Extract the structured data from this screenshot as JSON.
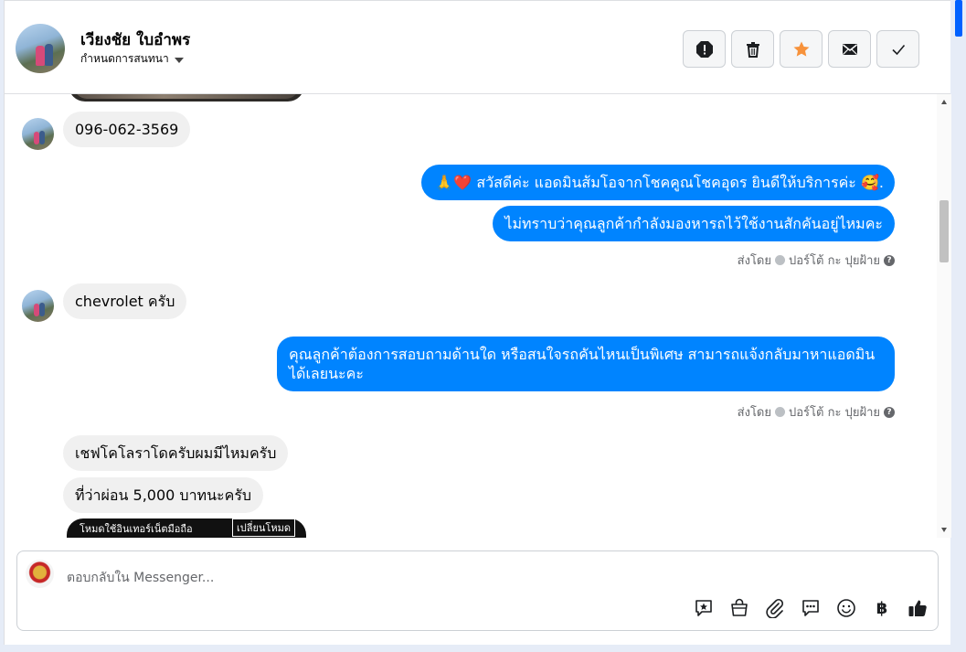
{
  "header": {
    "name": "เวียงชัย ใบอำพร",
    "assign_label": "กำหนดการสนทนา",
    "actions": [
      "alert",
      "delete",
      "star",
      "mail",
      "done"
    ],
    "colors": {
      "star": "#f7923b",
      "icon": "#333333"
    }
  },
  "messages": {
    "phone": "096-062-3569",
    "greeting": "🙏❤️ สวัสดีค่ะ แอดมินส้มโอจากโชคคูณโชคอุดร ยินดีให้บริการค่ะ 🥰.",
    "ask_car": "ไม่ทราบว่าคุณลูกค้ากำลังมองหารถไว้ใช้งานสักคันอยู่ไหมคะ",
    "sent_by_1": "ส่งโดย",
    "sender_1": "ปอร์โต้ กะ ปุยฝ้าย",
    "reply_chevrolet": "chevrolet ครับ",
    "ask_more": "คุณลูกค้าต้องการสอบถามด้านใด หรือสนใจรถคันไหนเป็นพิเศษ สามารถแจ้งกลับมาหาแอดมินได้เลยนะคะ",
    "sent_by_2": "ส่งโดย",
    "sender_2": "ปอร์โต้ กะ ปุยฝ้าย",
    "reply_colorado": "เชฟโคโลราโดครับผมมีไหมครับ",
    "reply_installment": "ที่ว่าผ่อน 5,000 บาทนะครับ",
    "image_caption_left": "โหมดใช้อินเทอร์เน็ตมือถือ",
    "image_caption_right": "เปลี่ยนโหมด"
  },
  "composer": {
    "placeholder": "ตอบกลับใน Messenger...",
    "tools": [
      "saved-reply-icon",
      "shop-bag-icon",
      "attach-icon",
      "chat-dots-icon",
      "emoji-icon",
      "baht-icon",
      "like-icon"
    ],
    "baht_glyph": "฿"
  },
  "theme": {
    "outgoing": "#0084ff",
    "incoming": "#f0f0f0",
    "like": "#1c1e21"
  }
}
